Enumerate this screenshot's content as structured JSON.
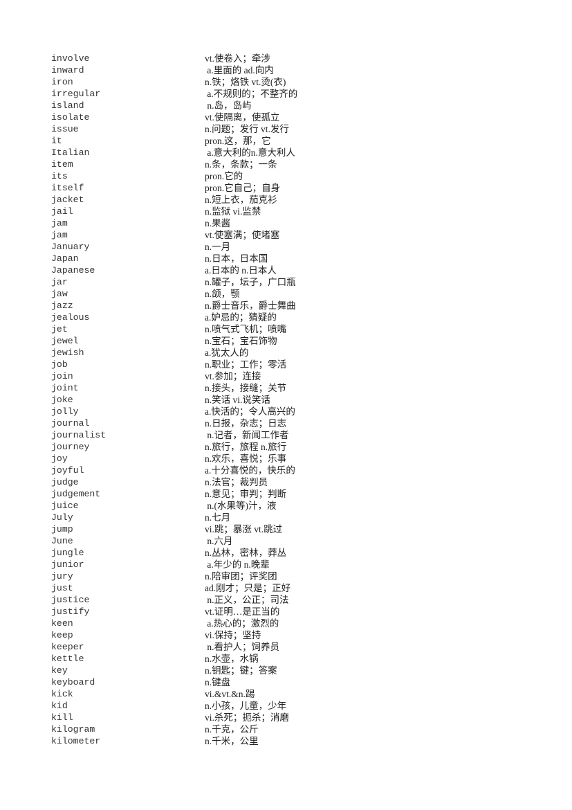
{
  "entries": [
    {
      "word": "involve",
      "def": "vt.使卷入；牵涉"
    },
    {
      "word": "inward",
      "def": " a.里面的 ad.向内"
    },
    {
      "word": "iron",
      "def": "n.铁；烙铁 vt.烫(衣)"
    },
    {
      "word": "irregular",
      "def": " a.不规则的；不整齐的"
    },
    {
      "word": "island",
      "def": " n.岛，岛屿"
    },
    {
      "word": "isolate",
      "def": "vt.使隔离，使孤立"
    },
    {
      "word": "issue",
      "def": "n.问题；发行 vt.发行"
    },
    {
      "word": "it",
      "def": "pron.这，那，它"
    },
    {
      "word": "Italian",
      "def": " a.意大利的n.意大利人"
    },
    {
      "word": "item",
      "def": "n.条，条款；一条"
    },
    {
      "word": "its",
      "def": "pron.它的"
    },
    {
      "word": "itself",
      "def": "pron.它自己；自身"
    },
    {
      "word": "jacket",
      "def": "n.短上衣，茄克衫"
    },
    {
      "word": "jail",
      "def": "n.监狱 vi.监禁"
    },
    {
      "word": "jam",
      "def": "n.果酱"
    },
    {
      "word": "jam",
      "def": "vt.使塞满；使堵塞"
    },
    {
      "word": "January",
      "def": "n.一月"
    },
    {
      "word": "Japan",
      "def": "n.日本，日本国"
    },
    {
      "word": "Japanese",
      "def": "a.日本的 n.日本人"
    },
    {
      "word": "jar",
      "def": "n.罐子，坛子，广口瓶"
    },
    {
      "word": "jaw",
      "def": "n.颌，颚"
    },
    {
      "word": "jazz",
      "def": "n.爵士音乐，爵士舞曲"
    },
    {
      "word": "jealous",
      "def": "a.妒忌的；猜疑的"
    },
    {
      "word": "jet",
      "def": "n.喷气式飞机；喷嘴"
    },
    {
      "word": "jewel",
      "def": "n.宝石；宝石饰物"
    },
    {
      "word": "jewish",
      "def": "a.犹太人的"
    },
    {
      "word": "job",
      "def": "n.职业；工作；零活"
    },
    {
      "word": "join",
      "def": "vt.参加；连接"
    },
    {
      "word": "joint",
      "def": "n.接头，接缝；关节"
    },
    {
      "word": "joke",
      "def": "n.笑话 vi.说笑话"
    },
    {
      "word": "jolly",
      "def": "a.快活的；令人高兴的"
    },
    {
      "word": "journal",
      "def": "n.日报，杂志；日志"
    },
    {
      "word": "journalist",
      "def": " n.记者，新闻工作者"
    },
    {
      "word": "journey",
      "def": "n.旅行，旅程 n.旅行"
    },
    {
      "word": "joy",
      "def": "n.欢乐，喜悦；乐事"
    },
    {
      "word": "joyful",
      "def": "a.十分喜悦的，快乐的"
    },
    {
      "word": "judge",
      "def": "n.法官；裁判员"
    },
    {
      "word": "judgement",
      "def": "n.意见；审判；判断"
    },
    {
      "word": "juice",
      "def": " n.(水果等)汁，液"
    },
    {
      "word": "July",
      "def": "n.七月"
    },
    {
      "word": "jump",
      "def": "vi.跳；暴涨 vt.跳过"
    },
    {
      "word": "June",
      "def": " n.六月"
    },
    {
      "word": "jungle",
      "def": "n.丛林，密林，莽丛"
    },
    {
      "word": "junior",
      "def": " a.年少的 n.晚辈"
    },
    {
      "word": "jury",
      "def": "n.陪审团；评奖团"
    },
    {
      "word": "just",
      "def": "ad.刚才；只是；正好"
    },
    {
      "word": "justice",
      "def": " n.正义，公正；司法"
    },
    {
      "word": "justify",
      "def": "vt.证明…是正当的"
    },
    {
      "word": "keen",
      "def": " a.热心的；激烈的"
    },
    {
      "word": "keep",
      "def": "vi.保持；坚持"
    },
    {
      "word": "keeper",
      "def": " n.看护人；饲养员"
    },
    {
      "word": "kettle",
      "def": "n.水壶，水锅"
    },
    {
      "word": "key",
      "def": "n.钥匙；键；答案"
    },
    {
      "word": "keyboard",
      "def": "n.键盘"
    },
    {
      "word": "kick",
      "def": "vi.&vt.&n.踢"
    },
    {
      "word": "kid",
      "def": "n.小孩，儿童，少年"
    },
    {
      "word": "kill",
      "def": "vi.杀死；扼杀；消磨"
    },
    {
      "word": "kilogram",
      "def": "n.千克，公斤"
    },
    {
      "word": "kilometer",
      "def": "n.千米，公里"
    }
  ]
}
